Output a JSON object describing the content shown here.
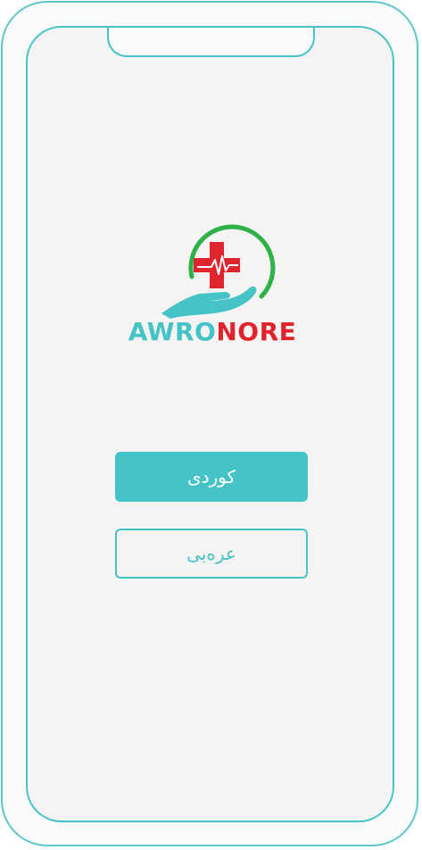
{
  "logo": {
    "text_part1": "AWRO",
    "text_part2": "NORE",
    "colors": {
      "teal": "#45c3c6",
      "red": "#e0242e",
      "green": "#2fb14a"
    }
  },
  "language_buttons": {
    "kurdish_label": "کوردی",
    "arabic_label": "عرەبی"
  },
  "colors": {
    "accent": "#45c3c6",
    "screen_background": "#f5f4f2"
  }
}
